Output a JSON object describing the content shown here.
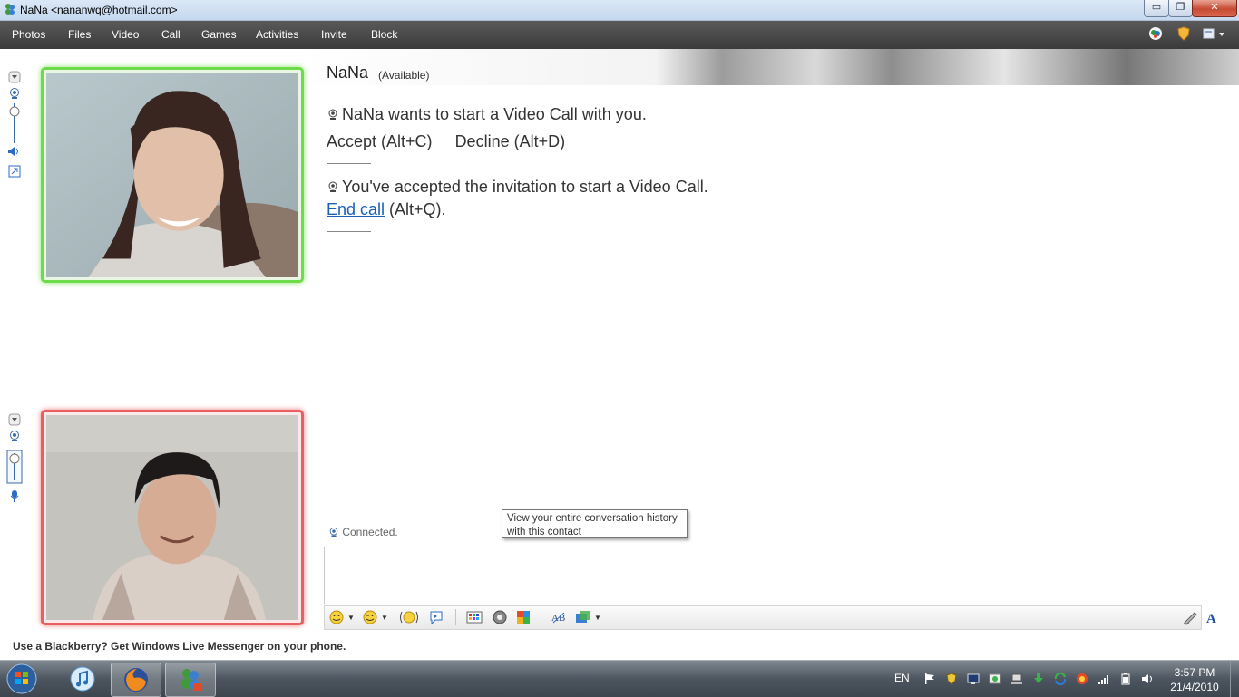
{
  "window": {
    "title": "NaNa <nananwq@hotmail.com>",
    "buttons": {
      "minimize": "▭",
      "maximize": "❐",
      "close": "✕"
    }
  },
  "menu": {
    "items": [
      "Photos",
      "Files",
      "Video",
      "Call",
      "Games",
      "Activities",
      "Invite",
      "Block"
    ],
    "right_icons": [
      "messenger-icon",
      "shield-icon",
      "options-icon"
    ]
  },
  "contact": {
    "name": "NaNa",
    "status": "(Available)"
  },
  "conversation": {
    "invite_text": "NaNa wants to start a Video Call with you.",
    "accept_label": "Accept (Alt+C)",
    "decline_label": "Decline (Alt+D)",
    "accepted_text": "You've accepted the invitation to start a Video Call.",
    "end_call_link": "End call",
    "end_call_hotkey": " (Alt+Q).",
    "connected_status": "Connected."
  },
  "tooltip": {
    "line1": "View your entire conversation history",
    "line2": "with this contact"
  },
  "input": {
    "value": "",
    "placeholder": ""
  },
  "toolbar_icons": [
    "emoticon-icon",
    "wink-icon",
    "nudge-icon",
    "voice-clip-icon",
    "background-icon",
    "game-icon",
    "activity-icon",
    "font-icon",
    "share-icon",
    "handwriting-icon",
    "text-style-icon"
  ],
  "ad": {
    "text": "Use a Blackberry? Get Windows Live Messenger on your phone."
  },
  "taskbar": {
    "language": "EN",
    "time": "3:57 PM",
    "date": "21/4/2010",
    "apps": [
      "itunes-icon",
      "firefox-icon",
      "messenger-icon"
    ]
  },
  "colors": {
    "self_frame": "#6edb4a",
    "contact_frame": "#e86060",
    "link": "#1a5fb4",
    "menubar": "#444444"
  }
}
